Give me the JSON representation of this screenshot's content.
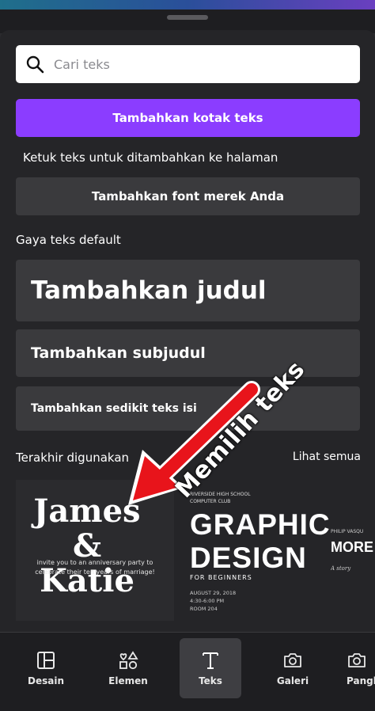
{
  "search": {
    "placeholder": "Cari teks"
  },
  "primary_button": {
    "label": "Tambahkan kotak teks"
  },
  "hint": "Ketuk teks untuk ditambahkan ke halaman",
  "brand_button": {
    "label": "Tambahkan font merek Anda"
  },
  "default_styles": {
    "label": "Gaya teks default",
    "heading": "Tambahkan judul",
    "subheading": "Tambahkan subjudul",
    "body": "Tambahkan sedikit teks isi"
  },
  "recent": {
    "label": "Terakhir digunakan",
    "see_all": "Lihat semua",
    "items": [
      {
        "name_line1": "James",
        "name_line2": "& Katie",
        "sub_line1": "invite you to an anniversary party to",
        "sub_line2": "celebrate their ten years of marriage!"
      },
      {
        "club_line1": "RIVERSIDE HIGH SCHOOL",
        "club_line2": "COMPUTER CLUB",
        "title_line1": "GRAPHIC",
        "title_line2": "DESIGN",
        "subtitle": "FOR BEGINNERS",
        "date_line1": "AUGUST 29, 2018",
        "date_line2": "4:30-6:00 PM",
        "date_line3": "ROOM 204"
      },
      {
        "author": "PHILIP VASQU",
        "title": "MORE",
        "sub": "A story"
      }
    ]
  },
  "annotation": {
    "text": "Memilih teks",
    "arrow_color": "#e8141b"
  },
  "nav": [
    {
      "label": "Desain",
      "icon": "layout-icon"
    },
    {
      "label": "Elemen",
      "icon": "shapes-icon"
    },
    {
      "label": "Teks",
      "icon": "text-icon",
      "active": true
    },
    {
      "label": "Galeri",
      "icon": "camera-icon"
    },
    {
      "label": "Pangk",
      "icon": "upload-icon"
    }
  ],
  "colors": {
    "accent": "#8b3dff",
    "panel": "#252528",
    "button": "#3a3a3d"
  }
}
